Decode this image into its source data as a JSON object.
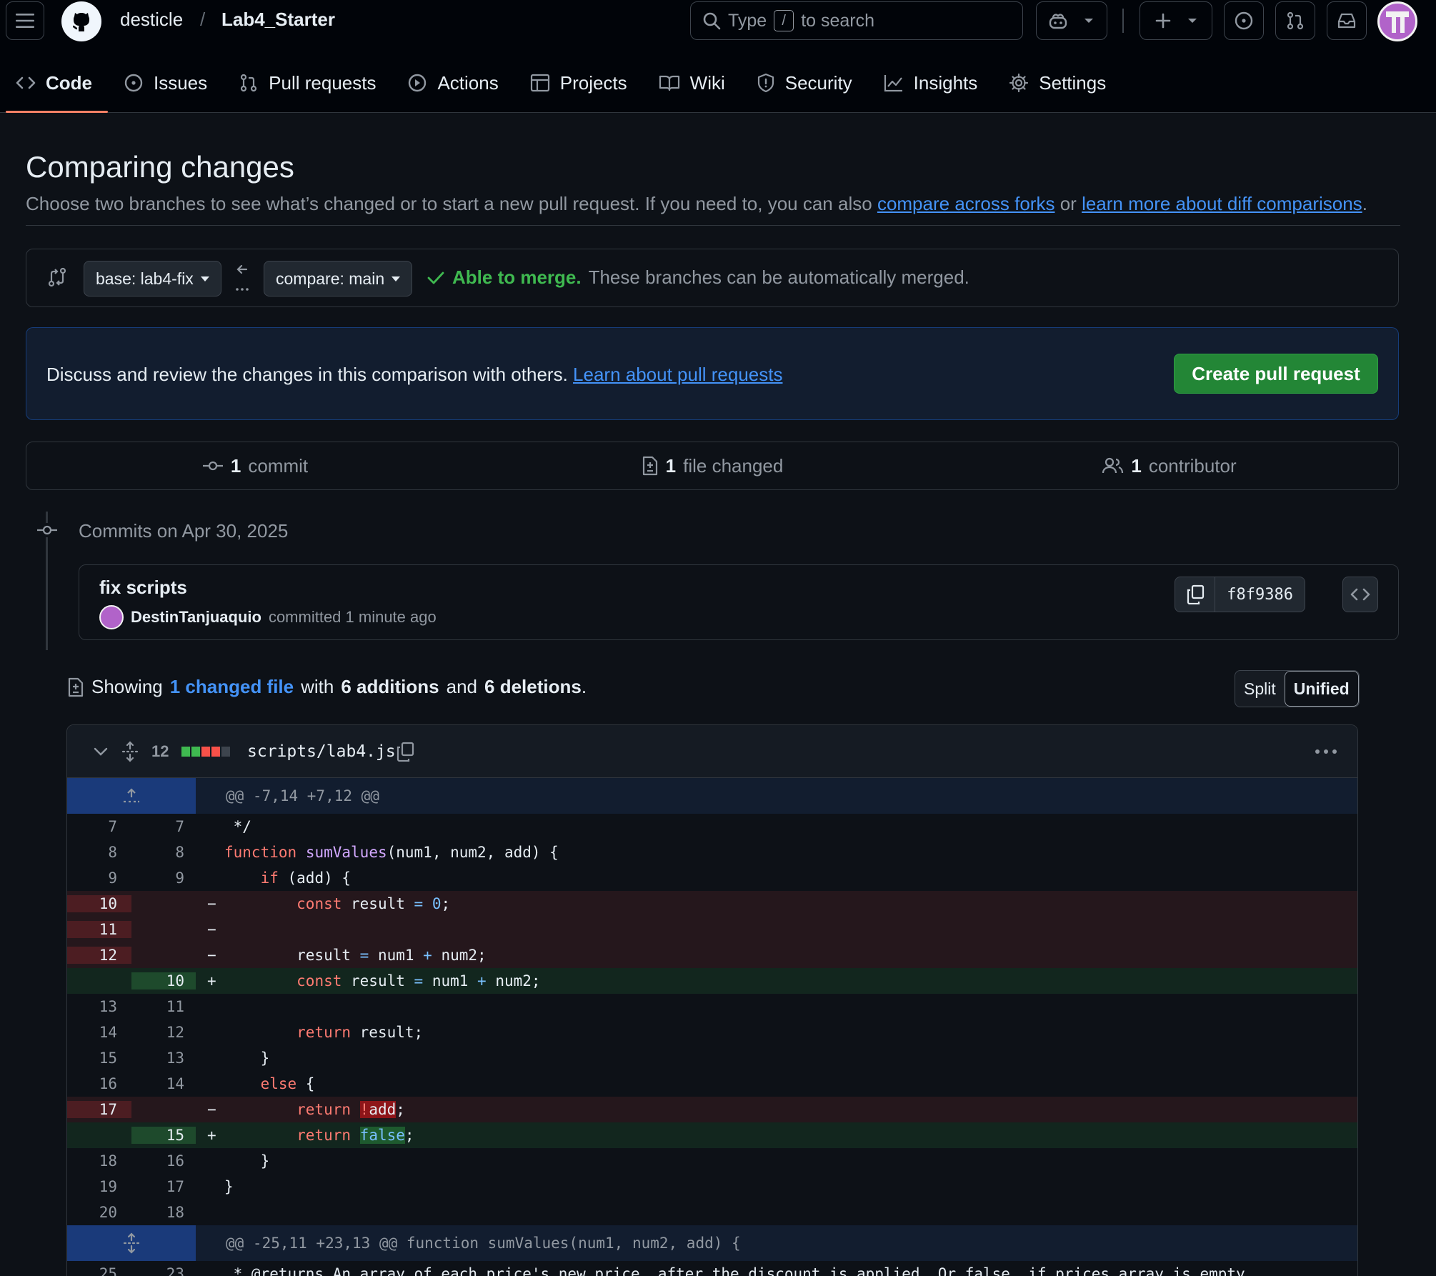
{
  "header": {
    "owner": "desticle",
    "repo": "Lab4_Starter",
    "search_placeholder": "Type",
    "search_key": "/",
    "search_suffix": "to search"
  },
  "tabs": [
    {
      "label": "Code",
      "icon": "code-icon"
    },
    {
      "label": "Issues",
      "icon": "issue-icon"
    },
    {
      "label": "Pull requests",
      "icon": "pull-request-icon"
    },
    {
      "label": "Actions",
      "icon": "play-icon"
    },
    {
      "label": "Projects",
      "icon": "table-icon"
    },
    {
      "label": "Wiki",
      "icon": "book-icon"
    },
    {
      "label": "Security",
      "icon": "shield-icon"
    },
    {
      "label": "Insights",
      "icon": "graph-icon"
    },
    {
      "label": "Settings",
      "icon": "gear-icon"
    }
  ],
  "page": {
    "title": "Comparing changes",
    "subtitle_prefix": "Choose two branches to see what’s changed or to start a new pull request. If you need to, you can also",
    "link_forks": "compare across forks",
    "subtitle_or": "or",
    "link_learn": "learn more about diff comparisons",
    "subtitle_end": "."
  },
  "branches": {
    "base": "base: lab4-fix",
    "compare": "compare: main",
    "merge_status": "Able to merge.",
    "merge_note": "These branches can be automatically merged."
  },
  "discuss": {
    "text": "Discuss and review the changes in this comparison with others.",
    "link": "Learn about pull requests",
    "button": "Create pull request"
  },
  "stats": {
    "commits_count": "1",
    "commits_label": "commit",
    "files_count": "1",
    "files_label": "file changed",
    "contrib_count": "1",
    "contrib_label": "contributor"
  },
  "commits": {
    "heading": "Commits on Apr 30, 2025",
    "title": "fix scripts",
    "author": "DestinTanjuaquio",
    "meta": "committed 1 minute ago",
    "sha": "f8f9386"
  },
  "summary": {
    "prefix": "Showing",
    "files_link": "1 changed file",
    "with": "with",
    "additions": "6 additions",
    "and": "and",
    "deletions": "6 deletions",
    "end": ".",
    "split": "Split",
    "unified": "Unified"
  },
  "file": {
    "change_count": "12",
    "name": "scripts/lab4.js",
    "diffstat_colors": [
      "#3fb950",
      "#3fb950",
      "#f85149",
      "#f85149",
      "#3d444d"
    ]
  },
  "diff": {
    "hunk1": "@@ -7,14 +7,12 @@",
    "hunk2": "@@ -25,11 +23,13 @@ function sumValues(num1, num2, add) {",
    "last_line_old": "25",
    "last_line_new": "23",
    "last_line_text": " * @returns An array of each price's new price, after the discount is applied. Or false, if prices array is empty."
  }
}
